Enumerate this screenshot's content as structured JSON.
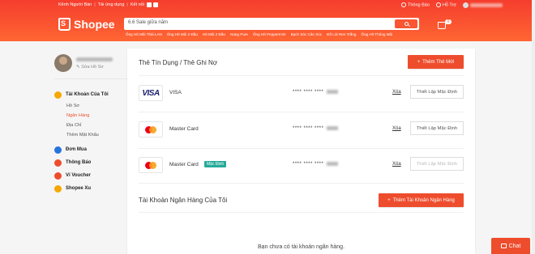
{
  "header": {
    "topbar_left": [
      "Kênh Người Bán",
      "Tải ứng dụng",
      "Kết nối"
    ],
    "notifications": "Thông Báo",
    "help": "Hỗ Trợ",
    "logo": "Shopee",
    "search_placeholder": "6.6 Sale giữa năm",
    "suggestions": [
      "Ống Hít Mũi Thái LAN",
      "Ống Hít Mũi 2 Đầu",
      "Hít Mũi 2 Đầu",
      "Nang Pure",
      "Ống Hít Peppermint",
      "Bạch Sóc Cân Xúc",
      "Đồ Lót Ren Trắng",
      "Ống Hít Thông Mũi"
    ],
    "cart_count": "0"
  },
  "sidebar": {
    "edit_profile": "Sửa Hồ Sơ",
    "account": "Tài Khoản Của Tôi",
    "sub": [
      "Hồ Sơ",
      "Ngân Hàng",
      "Địa Chỉ",
      "Thêm Mật Khẩu"
    ],
    "items": [
      "Đơn Mua",
      "Thông Báo",
      "Ví Voucher",
      "Shopee Xu"
    ],
    "icon_colors": [
      "#f6a700",
      "#2673dd",
      "#ee4d2d",
      "#ee4d2d",
      "#f6a700"
    ]
  },
  "cards": {
    "title": "Thẻ Tín Dụng / Thẻ Ghi Nợ",
    "add_label": "Thêm Thẻ Mới",
    "rows": [
      {
        "brand": "VISA",
        "name": "VISA",
        "masked": "**** **** ****",
        "delete": "Xóa",
        "action": "Thiết Lập Mặc Định"
      },
      {
        "brand": "mastercard",
        "name": "Master Card",
        "masked": "**** **** ****",
        "delete": "Xóa",
        "action": "Thiết Lập Mặc Định"
      },
      {
        "brand": "mastercard",
        "name": "Master Card",
        "badge": "Mặc Định",
        "masked": "**** **** ****",
        "delete": "Xóa",
        "action": "Thiết Lập Mặc Định"
      }
    ]
  },
  "bank": {
    "title": "Tài Khoản Ngân Hàng Của Tôi",
    "add_label": "Thêm Tài Khoản Ngân Hàng",
    "empty": "Bạn chưa có tài khoản ngân hàng."
  },
  "chat": "Chat",
  "colors": {
    "brand": "#ee4d2d",
    "badge": "#26aa99"
  }
}
